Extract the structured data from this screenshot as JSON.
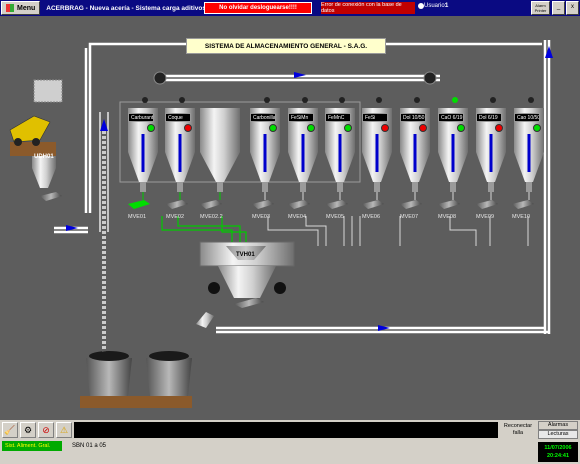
{
  "topbar": {
    "menu_label": "Menu",
    "app_title": "ACERBRAG - Nueva acería - Sistema carga aditivos",
    "alert_warning": "No olvidar desloguearse!!!!",
    "alert_connection": "Error de conexión con la base de datos",
    "user_label": "Usuario:",
    "user_value": "1",
    "alarm_print_label": "Alarm Printer",
    "window_buttons": [
      "_",
      "x"
    ]
  },
  "plant": {
    "title": "SISTEMA DE ALMACENAMIENTO GENERAL - S.A.G.",
    "truck_hopper_label": "UDH01",
    "weigh_hopper_label": "TVH01",
    "silos": [
      {
        "label": "Carburante",
        "status": "green"
      },
      {
        "label": "Coque",
        "status": "red"
      },
      {
        "label": "",
        "status": "none"
      },
      {
        "label": "Carbonilla",
        "status": "green"
      },
      {
        "label": "FeSiMn",
        "status": "green"
      },
      {
        "label": "FeMnC",
        "status": "green"
      },
      {
        "label": "FeSi",
        "status": "red"
      },
      {
        "label": "Dol 10/50",
        "status": "red"
      },
      {
        "label": "CaO 6/19",
        "status": "green"
      },
      {
        "label": "Dol 6/19",
        "status": "red"
      },
      {
        "label": "Cao 10/50",
        "status": "green"
      }
    ],
    "valves": [
      "MVE01",
      "MVE02",
      "MVE02.2",
      "MVE03",
      "MVE04",
      "MVE05",
      "MVE06",
      "MVE07",
      "MVE08",
      "MVE09",
      "MVE10"
    ]
  },
  "bottom": {
    "icons": [
      "broom-icon",
      "gear-icon",
      "no-entry-icon",
      "warning-icon"
    ],
    "reconnect_label": "Reconectar falla",
    "alarmas_label": "Alarmas",
    "lecturas_label": "Lecturas",
    "status_green": "Sist. Aliment. Gral.",
    "status_sbn": "SBN 01 a 05",
    "clock_date": "11/07/2006",
    "clock_time": "20:24:41"
  },
  "colors": {
    "background": "#5d5d5d",
    "titlebar": "#0a0a82",
    "flow_active": "#00cc00",
    "arrow_blue": "#0000dd",
    "alert_red": "#ff0000"
  }
}
